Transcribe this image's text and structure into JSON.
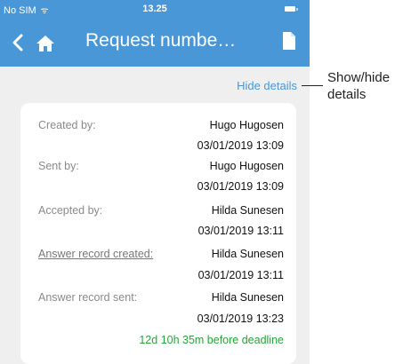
{
  "status": {
    "carrier": "No SIM",
    "time": "13.25"
  },
  "header": {
    "title": "Request numbe…"
  },
  "toggle": {
    "label": "Hide details"
  },
  "details": {
    "created_by_label": "Created by:",
    "created_by_name": "Hugo Hugosen",
    "created_by_time": "03/01/2019 13:09",
    "sent_by_label": "Sent by:",
    "sent_by_name": "Hugo Hugosen",
    "sent_by_time": "03/01/2019 13:09",
    "accepted_by_label": "Accepted by:",
    "accepted_by_name": "Hilda Sunesen",
    "accepted_by_time": "03/01/2019 13:11",
    "answer_created_label": "Answer record created:",
    "answer_created_name": "Hilda Sunesen",
    "answer_created_time": "03/01/2019 13:11",
    "answer_sent_label": "Answer record sent:",
    "answer_sent_name": "Hilda Sunesen",
    "answer_sent_time": "03/01/2019 13:23",
    "deadline": "12d 10h 35m before deadline"
  },
  "annotation": {
    "line1": "Show/hide",
    "line2": "details"
  },
  "colors": {
    "header": "#4a97d8",
    "link": "#4a97d8",
    "deadline": "#27a43a",
    "background": "#efefef"
  },
  "icons": [
    "back-chevron-icon",
    "home-icon",
    "document-icon",
    "wifi-icon",
    "battery-icon"
  ]
}
